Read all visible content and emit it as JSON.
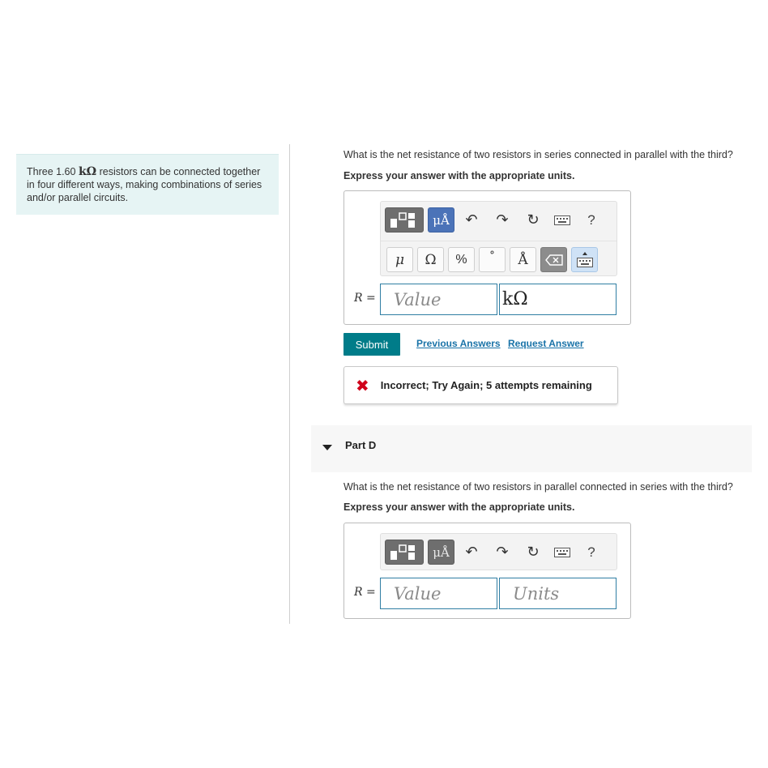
{
  "problem": {
    "prefix": "Three 1.60 ",
    "unit": "kΩ",
    "suffix": " resistors can be connected together in four different ways, making combinations of series and/or parallel circuits."
  },
  "partC": {
    "question": "What is the net resistance of two resistors in series connected in parallel with the third?",
    "instruction": "Express your answer with the appropriate units.",
    "toolbar_row1": {
      "units": "μÅ",
      "undo": "↶",
      "redo": "↷",
      "reset": "↻",
      "help": "?"
    },
    "toolbar_row2": {
      "mu": "μ",
      "omega": "Ω",
      "percent": "%",
      "degree": "°",
      "angstrom": "Å"
    },
    "r_label_var": "R",
    "r_label_eq": " =",
    "value_placeholder": "Value",
    "units_value": "kΩ"
  },
  "actions": {
    "submit": "Submit",
    "previous_answers": "Previous Answers",
    "request_answer": "Request Answer"
  },
  "feedback": {
    "icon": "✖",
    "message": "Incorrect; Try Again; 5 attempts remaining"
  },
  "partD": {
    "title": "Part D",
    "question": "What is the net resistance of two resistors in parallel connected in series with the third?",
    "instruction": "Express your answer with the appropriate units.",
    "toolbar_row1": {
      "units": "μÅ",
      "undo": "↶",
      "redo": "↷",
      "reset": "↻",
      "help": "?"
    },
    "r_label_var": "R",
    "r_label_eq": " =",
    "value_placeholder": "Value",
    "units_placeholder": "Units"
  },
  "icons": {
    "template": "templates-icon",
    "keyboard": "keyboard-icon",
    "backspace": "backspace-icon"
  }
}
